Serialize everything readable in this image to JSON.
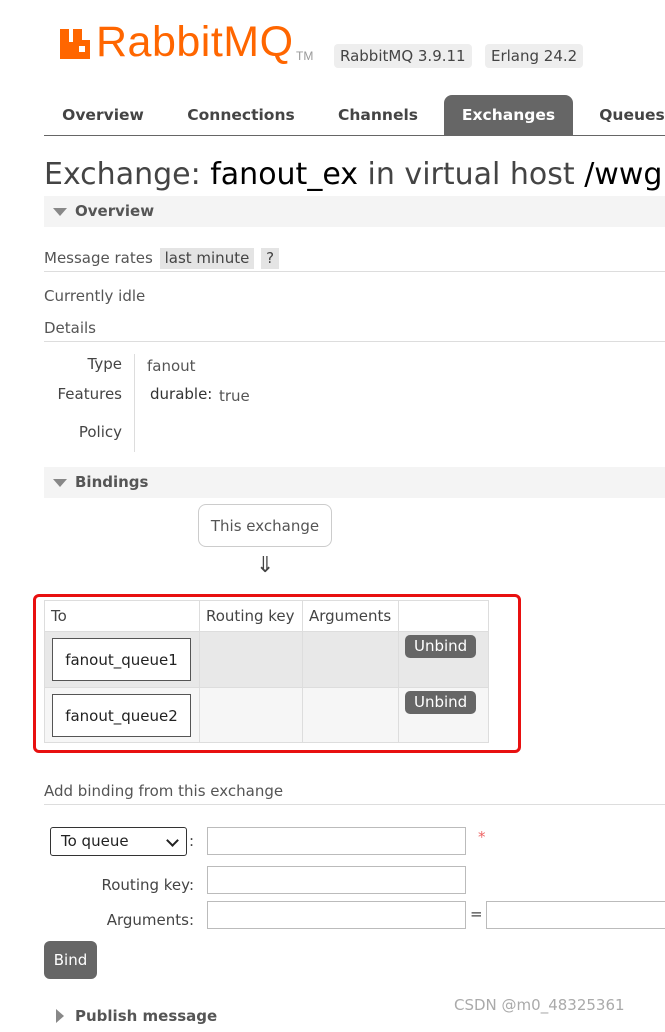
{
  "header": {
    "logo_text": "RabbitMQ",
    "logo_tm": "TM",
    "rabbitmq_version": "RabbitMQ 3.9.11",
    "erlang_version": "Erlang 24.2"
  },
  "nav": {
    "tabs": [
      "Overview",
      "Connections",
      "Channels",
      "Exchanges",
      "Queues"
    ],
    "active": "Exchanges"
  },
  "title": {
    "prefix": "Exchange: ",
    "name": "fanout_ex",
    "middle": " in virtual host ",
    "vhost": "/wwg"
  },
  "overview": {
    "section_label": "Overview",
    "message_rates_label": "Message rates",
    "message_rates_period": "last minute",
    "help_label": "?",
    "status": "Currently idle",
    "details_label": "Details",
    "type_label": "Type",
    "type_value": "fanout",
    "features_label": "Features",
    "durable_label": "durable:",
    "durable_value": "true",
    "policy_label": "Policy"
  },
  "bindings": {
    "section_label": "Bindings",
    "source_label": "This exchange",
    "arrow": "⇓",
    "columns": [
      "To",
      "Routing key",
      "Arguments"
    ],
    "rows": [
      {
        "to": "fanout_queue1",
        "routing_key": "",
        "arguments": "",
        "action": "Unbind"
      },
      {
        "to": "fanout_queue2",
        "routing_key": "",
        "arguments": "",
        "action": "Unbind"
      }
    ]
  },
  "add_binding": {
    "title": "Add binding from this exchange",
    "destination_type": "To queue",
    "colon": ":",
    "required_mark": "*",
    "routing_key_label": "Routing key:",
    "arguments_label": "Arguments:",
    "equals": "=",
    "bind_label": "Bind"
  },
  "publish": {
    "section_label": "Publish message"
  },
  "watermark": "CSDN @m0_48325361",
  "colors": {
    "brand": "#ff6600",
    "tab_active": "#666666",
    "highlight": "#e81010"
  }
}
